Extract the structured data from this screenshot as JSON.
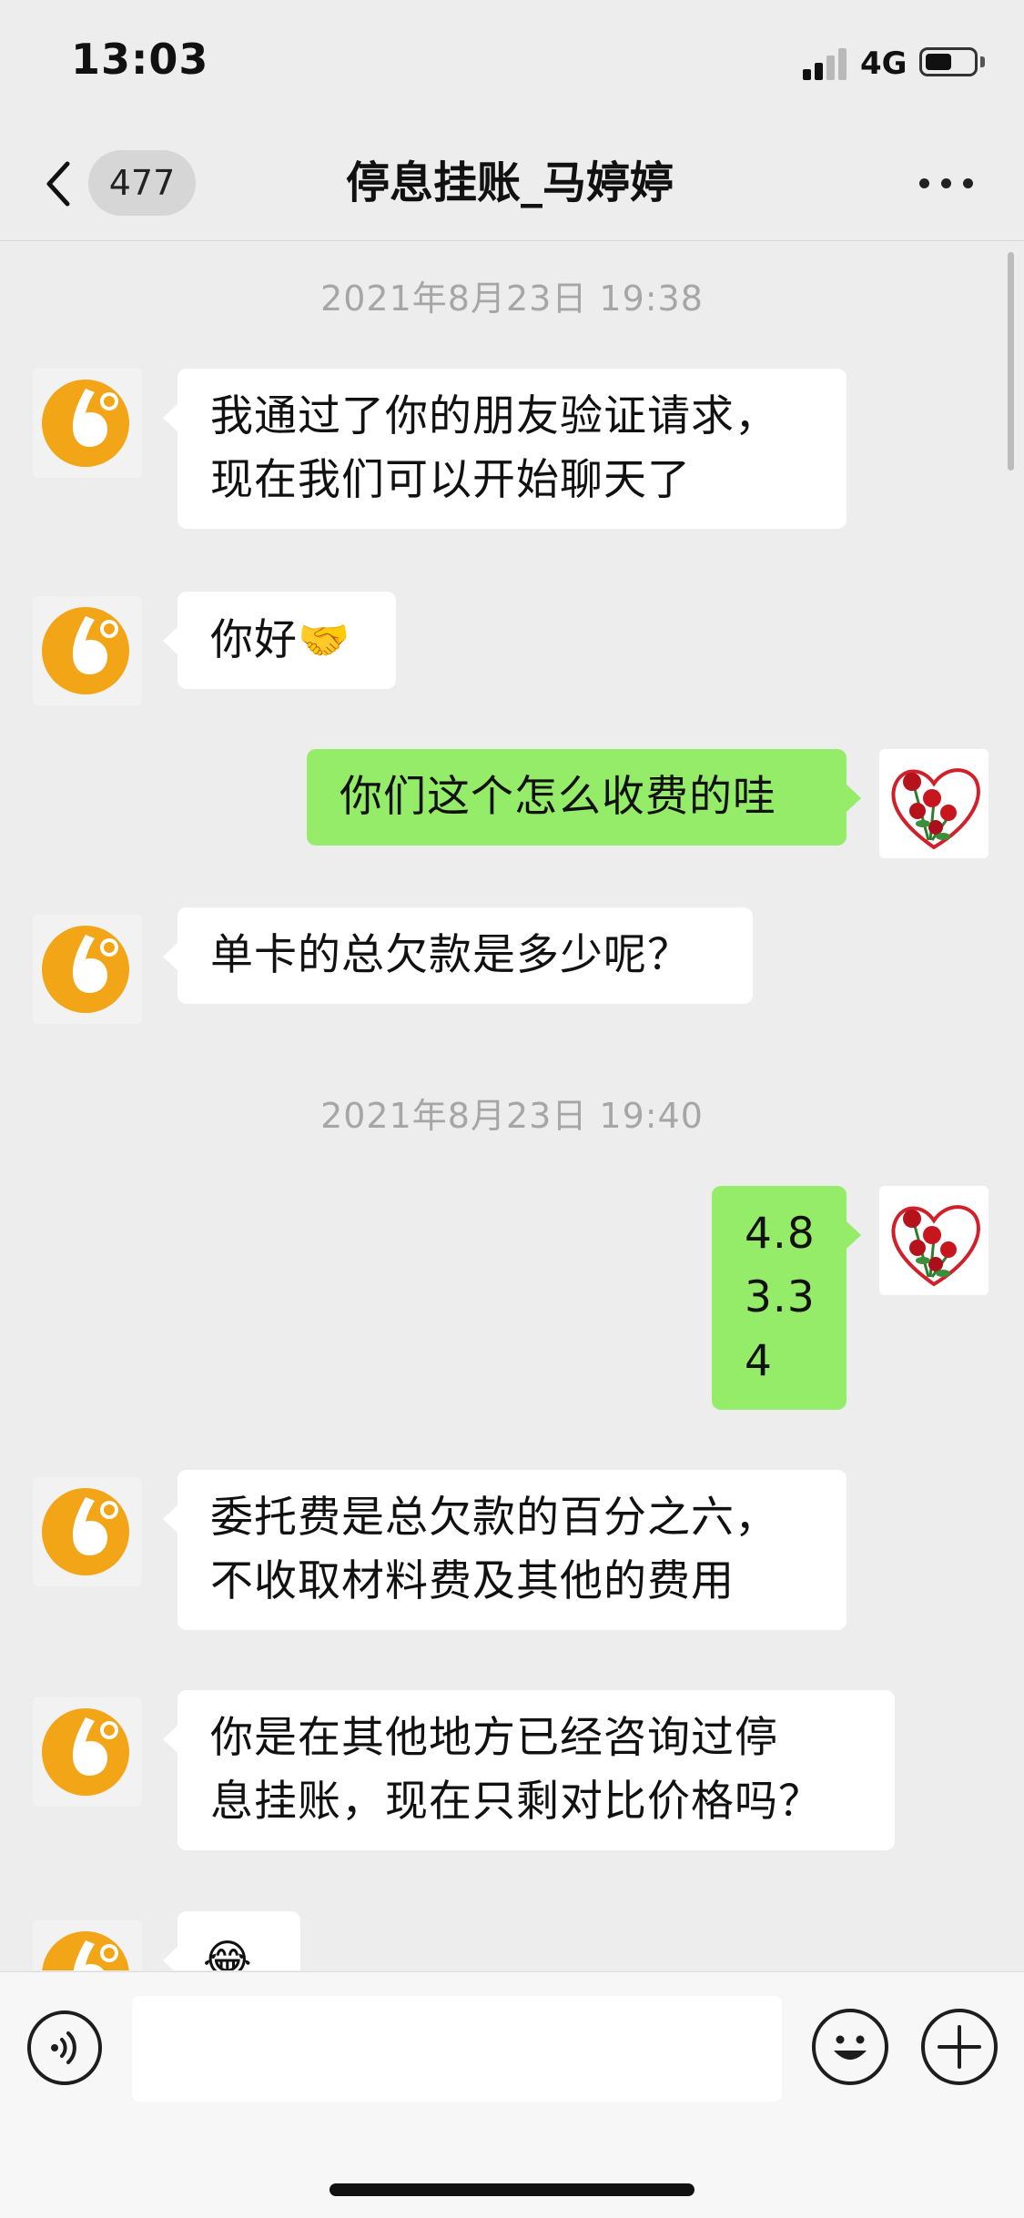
{
  "status_bar": {
    "time": "13:03",
    "network": "4G",
    "battery_level": 0.55
  },
  "nav": {
    "unread_count": "477",
    "title": "停息挂账_马婷婷"
  },
  "messages": [
    {
      "type": "timestamp",
      "text": "2021年8月23日 19:38"
    },
    {
      "type": "message",
      "side": "left",
      "lines": [
        "我通过了你的朋友验证请求，",
        "现在我们可以开始聊天了"
      ]
    },
    {
      "type": "message",
      "side": "left",
      "text": "你好",
      "emoji": "🤝"
    },
    {
      "type": "message",
      "side": "right",
      "text": "你们这个怎么收费的哇"
    },
    {
      "type": "message",
      "side": "left",
      "text": "单卡的总欠款是多少呢？"
    },
    {
      "type": "timestamp",
      "text": "2021年8月23日 19:40"
    },
    {
      "type": "message",
      "side": "right",
      "lines": [
        "4.8",
        "3.3",
        "4"
      ]
    },
    {
      "type": "message",
      "side": "left",
      "lines": [
        "委托费是总欠款的百分之六，",
        "不收取材料费及其他的费用"
      ]
    },
    {
      "type": "message",
      "side": "left",
      "lines": [
        "你是在其他地方已经咨询过停",
        "息挂账，现在只剩对比价格吗？"
      ]
    },
    {
      "type": "message",
      "side": "left",
      "emoji": "😂"
    }
  ],
  "input": {
    "value": ""
  },
  "colors": {
    "background": "#ededed",
    "sent_bubble": "#95ec69",
    "received_bubble": "#ffffff",
    "timestamp_text": "#a6a6a6",
    "avatar_orange": "#f2a516"
  },
  "icons": {
    "back": "chevron-left-icon",
    "more": "more-dots-icon",
    "voice": "voice-icon",
    "emoji": "smile-icon",
    "plus": "plus-icon",
    "contact_avatar": "orange-logo-avatar",
    "user_avatar": "roses-heart-avatar"
  }
}
